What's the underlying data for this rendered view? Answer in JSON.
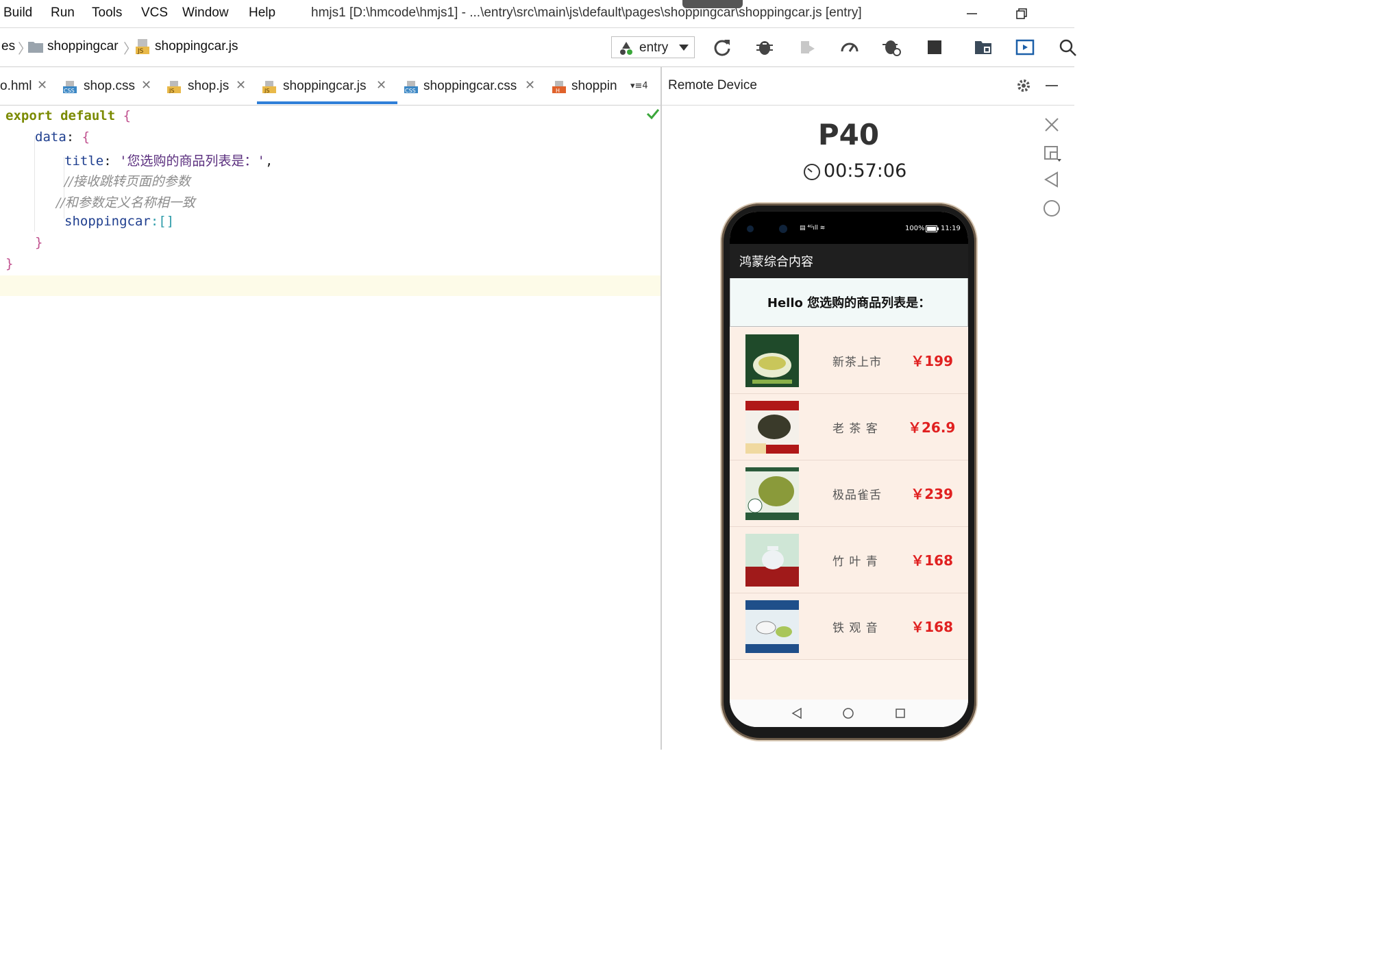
{
  "menubar": {
    "items": [
      "Build",
      "Run",
      "Tools",
      "VCS",
      "Window",
      "Help"
    ],
    "title": "hmjs1 [D:\\hmcode\\hmjs1] - ...\\entry\\src\\main\\js\\default\\pages\\shoppingcar\\shoppingcar.js [entry]"
  },
  "navbar": {
    "crumbs": [
      "es",
      "shoppingcar",
      "shoppingcar.js"
    ],
    "run_config": "entry"
  },
  "tabs": [
    {
      "label": "o.hml",
      "type": "hml"
    },
    {
      "label": "shop.css",
      "type": "css"
    },
    {
      "label": "shop.js",
      "type": "js"
    },
    {
      "label": "shoppingcar.js",
      "type": "js",
      "active": true
    },
    {
      "label": "shoppingcar.css",
      "type": "css"
    },
    {
      "label": "shoppin",
      "type": "hml"
    }
  ],
  "tabs_overflow": "4",
  "code": {
    "l1_kw": "export default",
    "l1_brace": "{",
    "l2_prop": "data",
    "l2_rest": ": ",
    "l2_brace": "{",
    "l3_prop": "title",
    "l3_sep": ": ",
    "l3_str": "'您选购的商品列表是：'",
    "l3_end": ",",
    "l4_cmt": "//接收跳转页面的参数",
    "l5_cmt": "//和参数定义名称相一致",
    "l6_prop": "shoppingcar",
    "l6_rest": ":[]",
    "l7_brace": "}",
    "l8_brace": "}"
  },
  "remote": {
    "title": "Remote Device",
    "device": "P40",
    "timer": "00:57:06"
  },
  "phone": {
    "status_battery": "100%",
    "status_time": "11:19",
    "app_title": "鸿蒙综合内容",
    "hello": "Hello 您选购的商品列表是：",
    "products": [
      {
        "name": "新茶上市",
        "price": "￥199"
      },
      {
        "name": "老 茶 客",
        "price": "￥26.9"
      },
      {
        "name": "极品雀舌",
        "price": "￥239"
      },
      {
        "name": "竹 叶 青",
        "price": "￥168"
      },
      {
        "name": "铁 观 音",
        "price": "￥168"
      }
    ]
  },
  "colors": {
    "accent": "#2f7fd8",
    "price": "#e02020",
    "keyword": "#7a8a00"
  }
}
